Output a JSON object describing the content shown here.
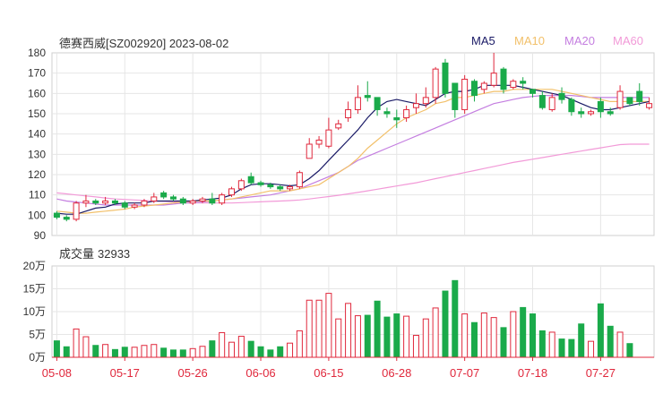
{
  "header": {
    "title": "德赛西威[SZ002920] 2023-08-02",
    "legend": [
      {
        "label": "MA5",
        "color": "#1a1a66"
      },
      {
        "label": "MA10",
        "color": "#f2c06a"
      },
      {
        "label": "MA20",
        "color": "#c47ee0"
      },
      {
        "label": "MA60",
        "color": "#f29ad8"
      }
    ]
  },
  "volume": {
    "label": "成交量",
    "value": "32933"
  },
  "chart_data": {
    "type": "candlestick",
    "colors": {
      "up": "#e0283c",
      "down": "#1aaa4a"
    },
    "price_axis": {
      "ticks": [
        "180",
        "170",
        "160",
        "150",
        "140",
        "130",
        "120",
        "110",
        "100",
        "90"
      ],
      "range": [
        90,
        180
      ]
    },
    "volume_axis": {
      "ticks": [
        "20万",
        "15万",
        "10万",
        "5万",
        "0万"
      ],
      "range": [
        0,
        20
      ]
    },
    "x_ticks": [
      {
        "label": "05-08",
        "index": 0
      },
      {
        "label": "05-17",
        "index": 7
      },
      {
        "label": "05-26",
        "index": 14
      },
      {
        "label": "06-06",
        "index": 21
      },
      {
        "label": "06-15",
        "index": 28
      },
      {
        "label": "06-28",
        "index": 35
      },
      {
        "label": "07-07",
        "index": 42
      },
      {
        "label": "07-18",
        "index": 49
      },
      {
        "label": "07-27",
        "index": 56
      }
    ],
    "candles": [
      [
        101,
        99,
        102,
        98
      ],
      [
        99,
        98,
        100,
        97
      ],
      [
        98,
        106,
        107,
        97
      ],
      [
        106,
        107,
        110,
        104
      ],
      [
        107,
        106,
        108,
        105
      ],
      [
        106,
        107,
        109,
        105
      ],
      [
        107,
        106,
        108,
        105
      ],
      [
        106,
        104,
        107,
        103
      ],
      [
        104,
        105,
        106,
        103
      ],
      [
        105,
        107,
        108,
        104
      ],
      [
        107,
        109,
        111,
        106
      ],
      [
        111,
        109,
        112,
        108
      ],
      [
        109,
        108,
        110,
        107
      ],
      [
        108,
        106,
        109,
        105
      ],
      [
        106,
        107,
        108,
        105
      ],
      [
        107,
        108,
        109,
        106
      ],
      [
        108,
        106,
        111,
        105
      ],
      [
        106,
        110,
        111,
        105
      ],
      [
        110,
        113,
        114,
        109
      ],
      [
        113,
        117,
        118,
        112
      ],
      [
        119,
        116,
        121,
        115
      ],
      [
        116,
        115,
        117,
        114
      ],
      [
        115,
        114,
        116,
        113
      ],
      [
        114,
        113,
        115,
        112
      ],
      [
        113,
        114,
        115,
        112
      ],
      [
        114,
        121,
        122,
        113
      ],
      [
        128,
        135,
        138,
        129
      ],
      [
        135,
        137,
        139,
        133
      ],
      [
        134,
        142,
        148,
        133
      ],
      [
        143,
        145,
        147,
        142
      ],
      [
        148,
        152,
        156,
        146
      ],
      [
        152,
        158,
        164,
        150
      ],
      [
        159,
        158,
        166,
        156
      ],
      [
        158,
        152,
        155,
        149
      ],
      [
        151,
        150,
        153,
        148
      ],
      [
        148,
        147,
        152,
        143
      ],
      [
        148,
        152,
        154,
        146
      ],
      [
        153,
        155,
        160,
        150
      ],
      [
        155,
        158,
        163,
        153
      ],
      [
        158,
        172,
        173,
        155
      ],
      [
        175,
        160,
        177,
        158
      ],
      [
        165,
        152,
        160,
        148
      ],
      [
        152,
        167,
        169,
        150
      ],
      [
        166,
        159,
        167,
        156
      ],
      [
        162,
        165,
        166,
        160
      ],
      [
        164,
        170,
        180,
        163
      ],
      [
        172,
        162,
        173,
        160
      ],
      [
        163,
        166,
        167,
        162
      ],
      [
        166,
        165,
        168,
        162
      ],
      [
        162,
        160,
        161,
        158
      ],
      [
        159,
        153,
        161,
        152
      ],
      [
        152,
        158,
        160,
        151
      ],
      [
        160,
        157,
        163,
        155
      ],
      [
        157,
        151,
        158,
        149
      ],
      [
        151,
        150,
        153,
        148
      ],
      [
        150,
        151,
        152,
        149
      ],
      [
        156,
        151,
        158,
        148
      ],
      [
        151,
        150,
        153,
        149
      ],
      [
        153,
        161,
        164,
        152
      ],
      [
        158,
        155,
        158,
        154
      ],
      [
        161,
        156,
        165,
        154
      ],
      [
        153,
        155,
        158,
        152
      ]
    ],
    "volume_values": [
      3.6,
      2.3,
      6.2,
      4.5,
      2.6,
      2.8,
      1.7,
      2.2,
      2.2,
      2.6,
      2.8,
      2.0,
      1.6,
      1.6,
      1.9,
      2.4,
      3.6,
      5.4,
      3.3,
      4.6,
      3.5,
      2.3,
      1.6,
      2.3,
      3.1,
      5.8,
      12.5,
      12.5,
      14.0,
      8.4,
      11.8,
      9.1,
      9.2,
      12.3,
      8.8,
      9.5,
      9.0,
      4.8,
      8.4,
      10.8,
      14.5,
      16.8,
      9.5,
      7.6,
      9.7,
      8.7,
      6.5,
      10.0,
      10.9,
      9.5,
      5.8,
      5.5,
      4.0,
      3.9,
      7.3,
      3.5,
      11.7,
      6.8,
      5.5,
      3.0
    ],
    "ma5": [
      101,
      100.5,
      100.5,
      102,
      103.5,
      104,
      105.5,
      106,
      106,
      106,
      107,
      107,
      107,
      107,
      107,
      107.5,
      108,
      108.5,
      110,
      113,
      115,
      115.5,
      115.5,
      115,
      114.5,
      115,
      118,
      122,
      127,
      132,
      137,
      142,
      148,
      153,
      156,
      157,
      156,
      155,
      154,
      157,
      160,
      161,
      161,
      162,
      164,
      164,
      164,
      164,
      163,
      162,
      161,
      160,
      159,
      157,
      155,
      153,
      152,
      152,
      153,
      154,
      155,
      156
    ],
    "ma10": [
      102,
      101.5,
      101,
      101,
      101.5,
      102,
      102.5,
      103,
      104,
      104.5,
      105,
      105.5,
      106,
      106.5,
      107,
      107,
      107,
      107.5,
      108,
      109,
      110,
      111,
      112,
      112,
      112,
      113,
      114,
      115,
      118,
      121,
      124,
      128,
      133,
      137,
      141,
      145,
      148,
      150,
      152,
      155,
      156,
      158,
      158,
      159,
      160,
      161,
      161,
      162,
      162,
      162,
      162,
      162,
      161,
      160,
      159,
      158,
      157,
      156,
      156,
      156,
      156,
      156
    ],
    "ma20": [
      108,
      107,
      106.5,
      106,
      105.5,
      105,
      105,
      105,
      105,
      105,
      105,
      105,
      105.5,
      106,
      106,
      106.5,
      107,
      107.5,
      108,
      108.5,
      109,
      109.5,
      110,
      111,
      112,
      113,
      115,
      117,
      119,
      121,
      124,
      127,
      129,
      131,
      133,
      135,
      137,
      139,
      141,
      143,
      145,
      147,
      149,
      151,
      153,
      155,
      156,
      157,
      158,
      158.5,
      159,
      159,
      159,
      159,
      158.5,
      158,
      158,
      158,
      158,
      158,
      158,
      158
    ],
    "ma60": [
      111,
      110.5,
      110,
      109.5,
      109,
      108.5,
      108,
      107.8,
      107.5,
      107.3,
      107,
      106.8,
      106.6,
      106.4,
      106.2,
      106,
      106,
      106,
      106,
      106.2,
      106.4,
      106.6,
      106.8,
      107,
      107.2,
      107.5,
      108,
      108.6,
      109.2,
      109.8,
      110.5,
      111.2,
      112,
      112.8,
      113.6,
      114.4,
      115.2,
      116,
      117,
      118,
      119,
      120,
      121,
      122,
      123,
      124,
      125,
      126,
      126.8,
      127.6,
      128.4,
      129.2,
      130,
      130.8,
      131.6,
      132.4,
      133.2,
      134,
      134.8,
      135,
      135,
      135
    ]
  }
}
